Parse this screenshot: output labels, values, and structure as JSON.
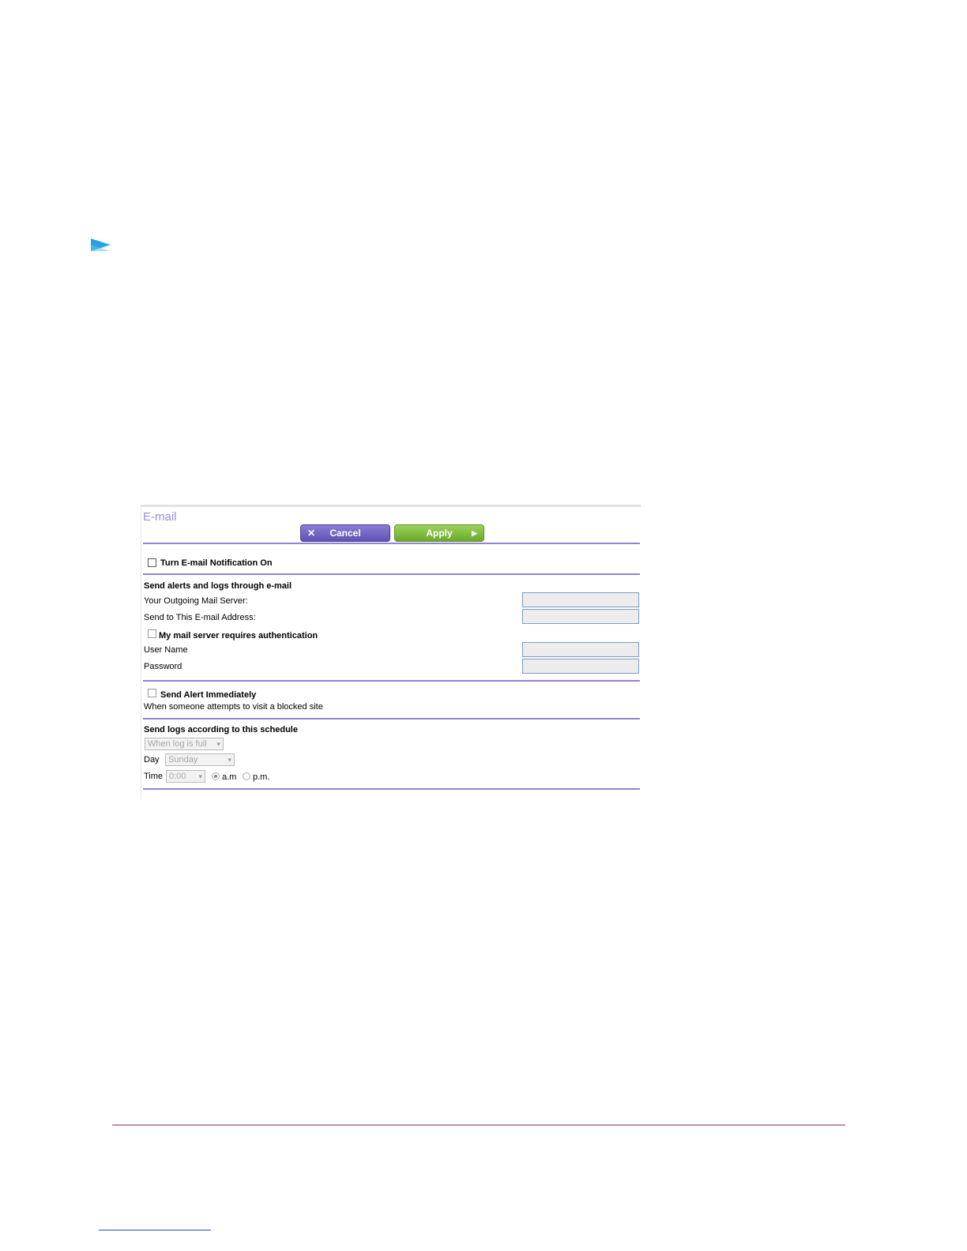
{
  "panel": {
    "title": "E-mail",
    "cancel_label": "Cancel",
    "apply_label": "Apply",
    "turn_on_label": "Turn E-mail Notification On",
    "send_alerts_heading": "Send alerts and logs through e-mail",
    "outgoing_server_label": "Your Outgoing Mail Server:",
    "send_to_label": "Send to This E-mail Address:",
    "auth_label": "My mail server requires authentication",
    "username_label": "User Name",
    "password_label": "Password",
    "send_alert_label": "Send Alert Immediately",
    "send_alert_desc": "When someone attempts to visit a blocked site",
    "schedule_heading": "Send logs according to this schedule",
    "schedule_value": "When log is full",
    "day_label": "Day",
    "day_value": "Sunday",
    "time_label": "Time",
    "time_value": "0:00",
    "am_label": "a.m",
    "pm_label": "p.m."
  },
  "colors": {
    "accent": "#8f84d6",
    "cancel": "#6f62c4",
    "apply": "#7fbb3c",
    "marker": "#29a3e0"
  },
  "icons": {
    "marker": "arrow-icon",
    "cancel": "close-icon",
    "apply": "play-icon"
  }
}
